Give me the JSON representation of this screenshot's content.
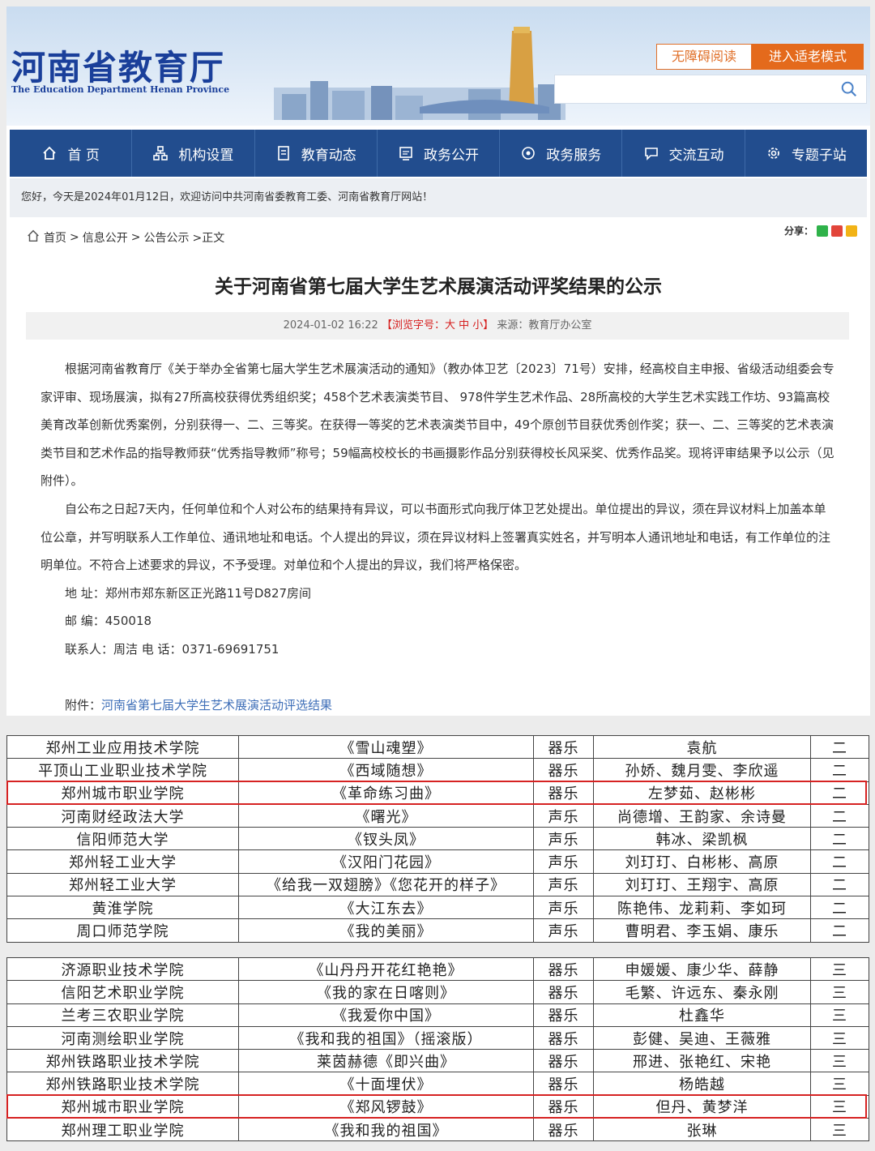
{
  "header": {
    "logo_cn": "河南省教育厅",
    "logo_en": "The Education Department Henan Province",
    "a11y_button": "无障碍阅读",
    "elder_button": "进入适老模式",
    "search_placeholder": ""
  },
  "nav": [
    "首 页",
    "机构设置",
    "教育动态",
    "政务公开",
    "政务服务",
    "交流互动",
    "专题子站"
  ],
  "welcome": "您好，今天是2024年01月12日，欢迎访问中共河南省委教育工委、河南省教育厅网站！",
  "breadcrumb": [
    "首页",
    ">",
    "信息公开",
    ">",
    "公告公示",
    ">正文"
  ],
  "share_label": "分享：",
  "article": {
    "title": "关于河南省第七届大学生艺术展演活动评奖结果的公示",
    "date": "2024-01-02 16:22",
    "font_size_label": "【浏览字号：大 中 小】",
    "source": "来源：教育厅办公室",
    "para1": "根据河南省教育厅《关于举办全省第七届大学生艺术展演活动的通知》（教办体卫艺〔2023〕71号）安排，经高校自主申报、省级活动组委会专家评审、现场展演，拟有27所高校获得优秀组织奖；458个艺术表演类节目、 978件学生艺术作品、28所高校的大学生艺术实践工作坊、93篇高校美育改革创新优秀案例，分别获得一、二、三等奖。在获得一等奖的艺术表演类节目中，49个原创节目获优秀创作奖；获一、二、三等奖的艺术表演类节目和艺术作品的指导教师获“优秀指导教师”称号；59幅高校校长的书画摄影作品分别获得校长风采奖、优秀作品奖。现将评审结果予以公示（见附件）。",
    "para2": "自公布之日起7天内，任何单位和个人对公布的结果持有异议，可以书面形式向我厅体卫艺处提出。单位提出的异议，须在异议材料上加盖本单位公章，并写明联系人工作单位、通讯地址和电话。个人提出的异议，须在异议材料上签署真实姓名，并写明本人通讯地址和电话，有工作单位的注明单位。不符合上述要求的异议，不予受理。对单位和个人提出的异议，我们将严格保密。",
    "address": "地 址：郑州市郑东新区正光路11号D827房间",
    "postcode": "邮 编：450018",
    "contact": "联系人：周洁 电 话：0371-69691751",
    "attach_label": "附件：",
    "attach_link": "河南省第七届大学生艺术展演活动评选结果"
  },
  "table1": [
    [
      "郑州工业应用技术学院",
      "《雪山魂塑》",
      "器乐",
      "袁航",
      "二"
    ],
    [
      "平顶山工业职业技术学院",
      "《西域随想》",
      "器乐",
      "孙娇、魏月雯、李欣遥",
      "二"
    ],
    [
      "郑州城市职业学院",
      "《革命练习曲》",
      "器乐",
      "左梦茹、赵彬彬",
      "二"
    ],
    [
      "河南财经政法大学",
      "《曙光》",
      "声乐",
      "尚德增、王韵家、余诗曼",
      "二"
    ],
    [
      "信阳师范大学",
      "《钗头凤》",
      "声乐",
      "韩冰、梁凯枫",
      "二"
    ],
    [
      "郑州轻工业大学",
      "《汉阳门花园》",
      "声乐",
      "刘玎玎、白彬彬、高原",
      "二"
    ],
    [
      "郑州轻工业大学",
      "《给我一双翅膀》《您花开的样子》",
      "声乐",
      "刘玎玎、王翔宇、高原",
      "二"
    ],
    [
      "黄淮学院",
      "《大江东去》",
      "声乐",
      "陈艳伟、龙莉莉、李如珂",
      "二"
    ],
    [
      "周口师范学院",
      "《我的美丽》",
      "声乐",
      "曹明君、李玉娟、康乐",
      "二"
    ]
  ],
  "table2": [
    [
      "济源职业技术学院",
      "《山丹丹开花红艳艳》",
      "器乐",
      "申媛媛、康少华、薛静",
      "三"
    ],
    [
      "信阳艺术职业学院",
      "《我的家在日喀则》",
      "器乐",
      "毛繁、许远东、秦永刚",
      "三"
    ],
    [
      "兰考三农职业学院",
      "《我爱你中国》",
      "器乐",
      "杜鑫华",
      "三"
    ],
    [
      "河南测绘职业学院",
      "《我和我的祖国》（摇滚版）",
      "器乐",
      "彭健、吴迪、王薇雅",
      "三"
    ],
    [
      "郑州铁路职业技术学院",
      "莱茵赫德《即兴曲》",
      "器乐",
      "邢进、张艳红、宋艳",
      "三"
    ],
    [
      "郑州铁路职业技术学院",
      "《十面埋伏》",
      "器乐",
      "杨皓越",
      "三"
    ],
    [
      "郑州城市职业学院",
      "《郑风锣鼓》",
      "器乐",
      "但丹、黄梦洋",
      "三"
    ],
    [
      "郑州理工职业学院",
      "《我和我的祖国》",
      "器乐",
      "张琳",
      "三"
    ]
  ]
}
